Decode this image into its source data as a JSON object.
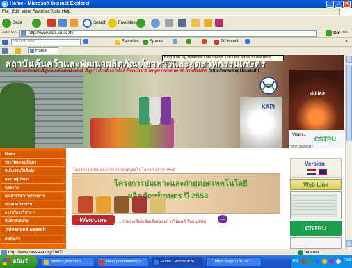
{
  "window": {
    "title": "Home - Microsoft Internet Explorer",
    "minimize_label": "_",
    "maximize_label": "□",
    "close_label": "✕"
  },
  "menu": [
    "File",
    "Edit",
    "View",
    "Favorites",
    "Tools",
    "Help"
  ],
  "toolbar": {
    "back_label": "Back",
    "search_label": "Search",
    "favorites_label": "Favorites"
  },
  "address": {
    "label": "Address",
    "url": "http://www.kapi.ku.ac.th/",
    "go_label": "Go",
    "links_label": "Links"
  },
  "livebar": {
    "search_placeholder": "Search web...",
    "favorites_label": "Favorites",
    "spaces_label": "Spaces",
    "pchealth_label": "PC Health"
  },
  "tab": {
    "label": "Home"
  },
  "tooltip": "Blog it on My Windows Live Space. Click the arrow to see more options.",
  "banner": {
    "thai_title": "สถาบันค้นคว้าและพัฒนาผลิตภัณฑ์อาหารและอุตสาหกรรมเกษตร",
    "english_title": "Kasetsart Agricultural and Agro-Industrial Product Improvement Institute",
    "url": "(http://www.kapi.ku.ac.th)",
    "kapi_label": "KAPI",
    "lab_label": "ddd08",
    "cstru_small": "CSTRU",
    "sign_text": "Vitam...",
    "thai_small": "***สถาบันเสียเม่า"
  },
  "sidebar": {
    "items": [
      "Home",
      "ประวัติความเป็นมา",
      "หน่วยงานในสังกัด",
      "ผลงานผู้บริหาร",
      "บุคลากร",
      "เอกสารวิชาการ/วารสาร",
      "ข่าวและกิจกรรม",
      "การบริการวิชาการ",
      "สินค้าจำหน่าย",
      "Advanced Search",
      "ติดต่อเรา"
    ]
  },
  "main": {
    "headline": "โครงการอบรมและการถ่ายทอดเทคโนโลยี ประจำปี 2553",
    "promo_line1": "โครงการบ่มเพาะและถ่ายทอดเทคโนโลยี",
    "promo_line2": "ผลิตภัณฑ์เกษตร ปี 2553",
    "welcome_label": "Welcome",
    "welcome_text": "....รายละเอียดเพิ่มเติมเฉลยการให้ผลดิ ไขอนุสรณ์",
    "new_badge": "new"
  },
  "rightcol": {
    "version_title": "Version",
    "weblink_label": "Web Link",
    "cstru_label": "CSTRU"
  },
  "status": {
    "text": "http://www.cassava.org/2007/",
    "zone": "Internet"
  },
  "taskbar": {
    "start_label": "start",
    "tasks": [
      {
        "label": "present_kapi2553",
        "color": "#e0c030"
      },
      {
        "label": "KAPI presentation_v...",
        "color": "#d04020"
      },
      {
        "label": "Home - Microsoft In...",
        "color": "#3a78d8"
      },
      {
        "label": "https://login11.ku.ac...",
        "color": "#3a78d8"
      }
    ],
    "tray_lang": "EN",
    "clock": "7:53"
  },
  "colors": {
    "sidebar_bg": "#e56a00",
    "titlebar_blue": "#0a5fe0",
    "taskbar_start_green": "#2f8a22",
    "cstru_green": "#1aa04a"
  }
}
